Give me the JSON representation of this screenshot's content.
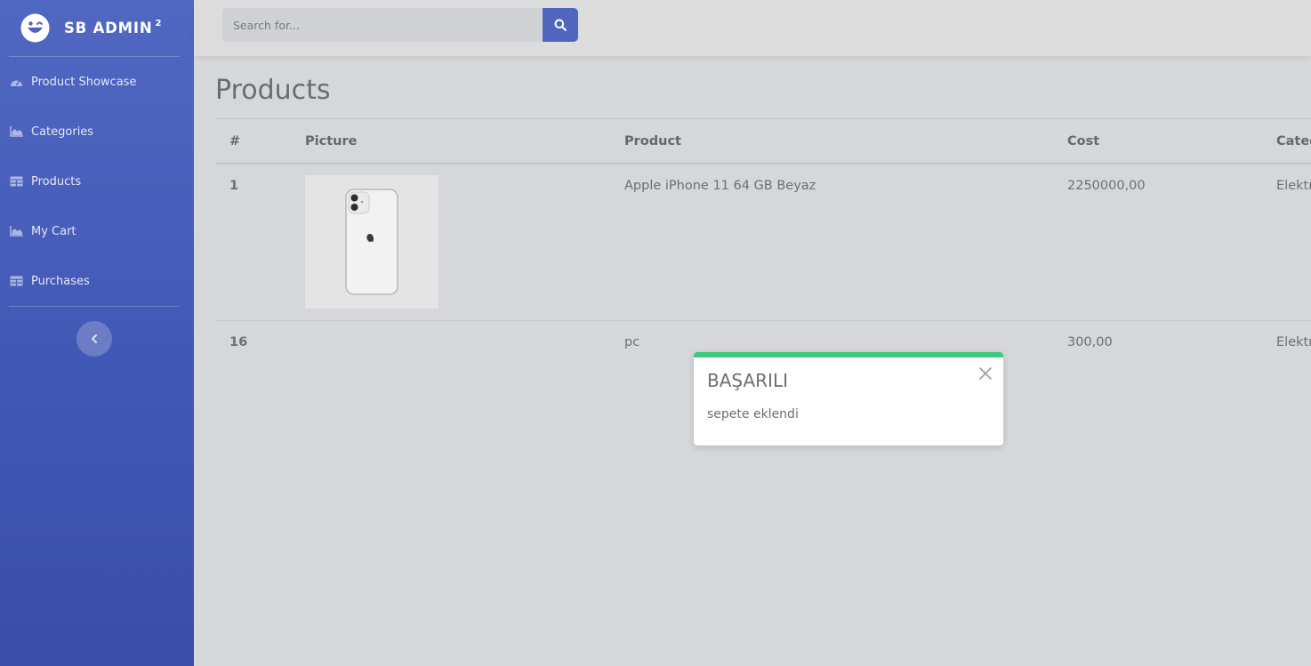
{
  "brand": {
    "name": "SB ADMIN",
    "version": "2"
  },
  "sidebar": {
    "items": [
      {
        "label": "Product Showcase",
        "icon": "tachometer-icon"
      },
      {
        "label": "Categories",
        "icon": "chart-area-icon"
      },
      {
        "label": "Products",
        "icon": "table-icon"
      },
      {
        "label": "My Cart",
        "icon": "chart-area-icon"
      },
      {
        "label": "Purchases",
        "icon": "table-icon"
      }
    ],
    "toggle_icon": "chevron-left-icon"
  },
  "topbar": {
    "search": {
      "placeholder": "Search for...",
      "value": ""
    },
    "search_icon": "search-icon"
  },
  "main": {
    "title": "Products",
    "table": {
      "headers": [
        "#",
        "Picture",
        "Product",
        "Cost",
        "Categ"
      ],
      "rows": [
        {
          "id": "1",
          "picture": "iphone-image",
          "product": "Apple iPhone 11 64 GB Beyaz",
          "cost": "2250000,00",
          "category": "Elektr"
        },
        {
          "id": "16",
          "picture": "",
          "product": "pc",
          "cost": "300,00",
          "category": "Elektr"
        }
      ]
    }
  },
  "toast": {
    "title": "BAŞARILI",
    "message": "sepete eklendi",
    "accent": "#3ec97b"
  },
  "colors": {
    "sidebar": "#4e63bf",
    "primary": "#5065bd",
    "success": "#3ec97b"
  }
}
